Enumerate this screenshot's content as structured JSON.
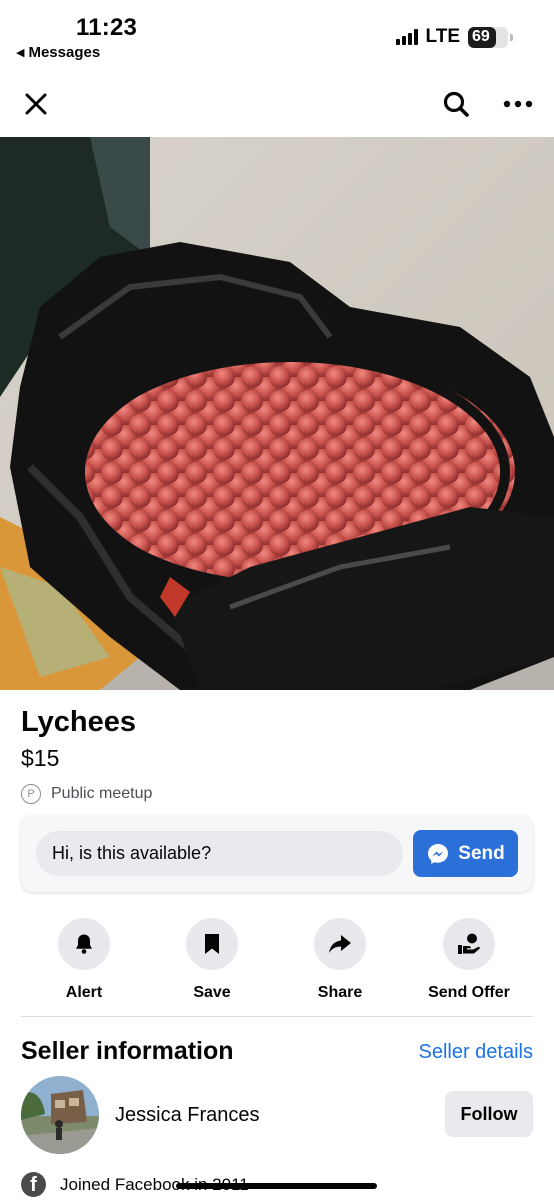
{
  "status_bar": {
    "time": "11:23",
    "back_app": "Messages",
    "network": "LTE",
    "battery": "69",
    "battery_level": 0.69
  },
  "top_bar": {
    "close_icon": "close-icon",
    "search_icon": "search-icon",
    "more_icon": "more-horizontal-icon"
  },
  "listing": {
    "title": "Lychees",
    "price": "$15",
    "meetup": "Public meetup",
    "meetup_icon": "P"
  },
  "message": {
    "value": "Hi, is this available?",
    "send_label": "Send"
  },
  "actions": [
    {
      "label": "Alert",
      "icon": "bell-icon"
    },
    {
      "label": "Save",
      "icon": "bookmark-icon"
    },
    {
      "label": "Share",
      "icon": "share-arrow-icon"
    },
    {
      "label": "Send Offer",
      "icon": "offer-hand-icon"
    }
  ],
  "seller": {
    "heading": "Seller information",
    "details_link": "Seller details",
    "name": "Jessica Frances",
    "follow_label": "Follow",
    "joined": "Joined Facebook in 2011"
  },
  "colors": {
    "accent": "#2b6fd8",
    "link": "#1b74e4",
    "button_bg": "#e9eaee"
  }
}
